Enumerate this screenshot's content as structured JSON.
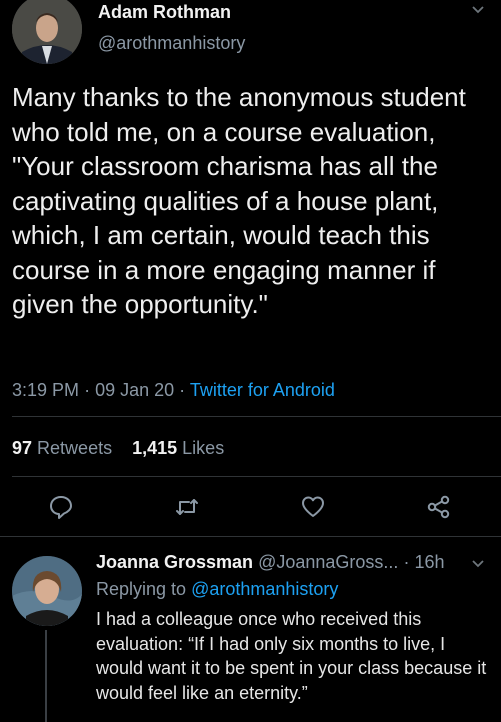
{
  "tweet": {
    "author_name": "Adam Rothman",
    "author_handle": "@arothmanhistory",
    "text": "Many thanks to the anonymous student who told me, on a course evaluation, \"Your classroom charisma has all the captivating qualities of a house plant, which, I am certain, would teach this course in a more engaging manner if given the opportunity.\"",
    "time": "3:19 PM",
    "date": "09 Jan 20",
    "source": "Twitter for Android",
    "retweets_count": "97",
    "retweets_label": "Retweets",
    "likes_count": "1,415",
    "likes_label": "Likes"
  },
  "actions": [
    "reply-icon",
    "retweet-icon",
    "like-icon",
    "share-icon"
  ],
  "reply": {
    "author_name": "Joanna Grossman",
    "author_handle": "@JoannaGross...",
    "age": "16h",
    "replying_prefix": "Replying to",
    "replying_handle": "@arothmanhistory",
    "text": "I had a colleague once who received this evaluation: “If I had only six months to live, I would want it to be spent in your class because it would feel like an eternity.”"
  },
  "colors": {
    "background": "#000000",
    "text": "#e9e9e9",
    "muted": "#8b98a5",
    "link": "#1da1f2",
    "divider": "#2f3336"
  }
}
